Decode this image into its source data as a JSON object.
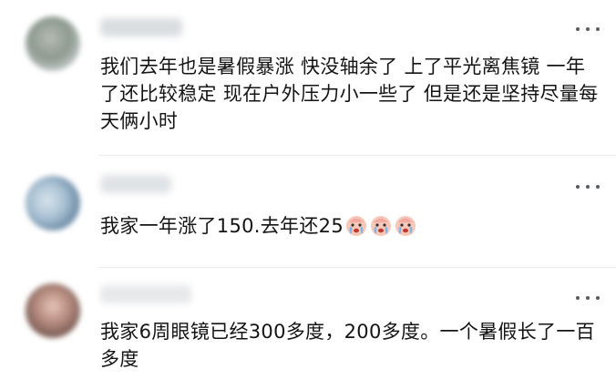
{
  "comments": [
    {
      "id": "c1",
      "text": "我们去年也是暑假暴涨 快没轴余了 上了平光离焦镜 一年了还比较稳定 现在户外压力小一些了 但是还是坚持尽量每天俩小时",
      "emoji_count": 0
    },
    {
      "id": "c2",
      "text": "我家一年涨了150.去年还25",
      "emojis": [
        "crying-face-emoji",
        "crying-face-emoji",
        "crying-face-emoji"
      ]
    },
    {
      "id": "c3",
      "text": "我家6周眼镜已经300多度，200多度。一个暑假长了一百多度",
      "emoji_count": 0
    }
  ],
  "colors": {
    "text": "#141414",
    "divider": "#ececec",
    "more_icon": "#555b61",
    "emoji_face": "#f7c7b8",
    "emoji_tear": "#7fb6ea"
  }
}
